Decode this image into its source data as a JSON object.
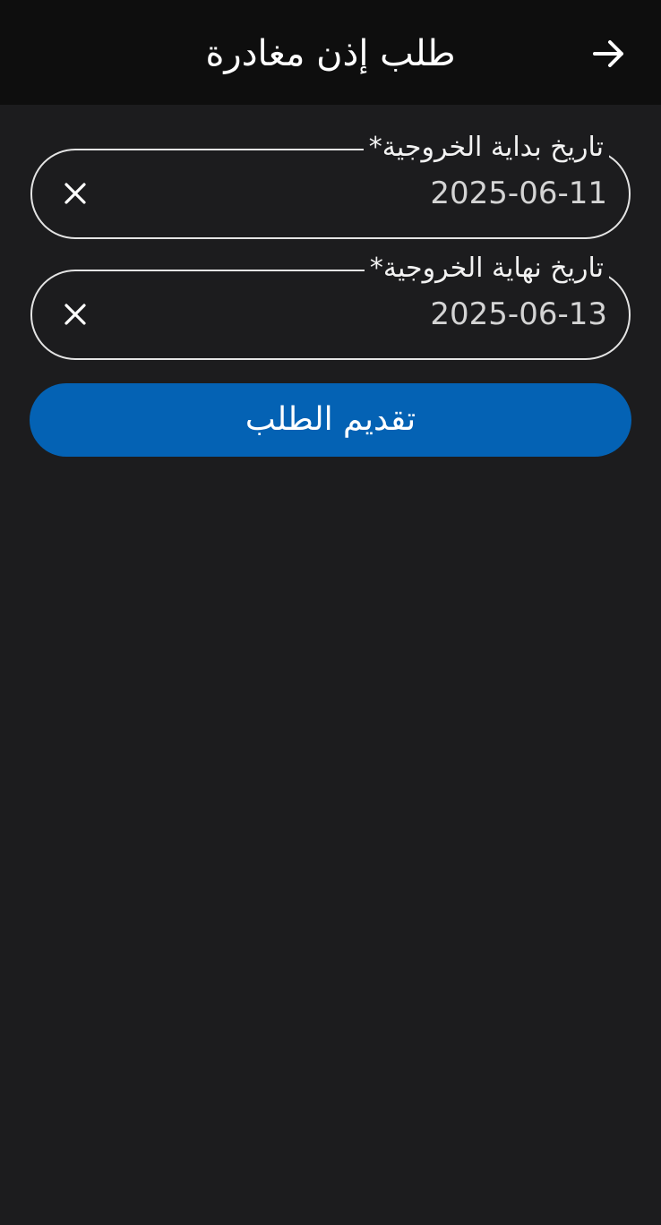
{
  "header": {
    "title": "طلب إذن مغادرة",
    "back_icon": "arrow-right-icon"
  },
  "form": {
    "start_date": {
      "label": "تاريخ بداية الخروجية*",
      "value": "2025-06-11",
      "clear_icon": "close-icon"
    },
    "end_date": {
      "label": "تاريخ نهاية الخروجية*",
      "value": "2025-06-13",
      "clear_icon": "close-icon"
    },
    "submit_label": "تقديم الطلب"
  },
  "colors": {
    "background": "#1c1c1e",
    "app_bar": "#0e0e0e",
    "primary_button": "#0462b4",
    "field_border": "#e4e4e4"
  }
}
